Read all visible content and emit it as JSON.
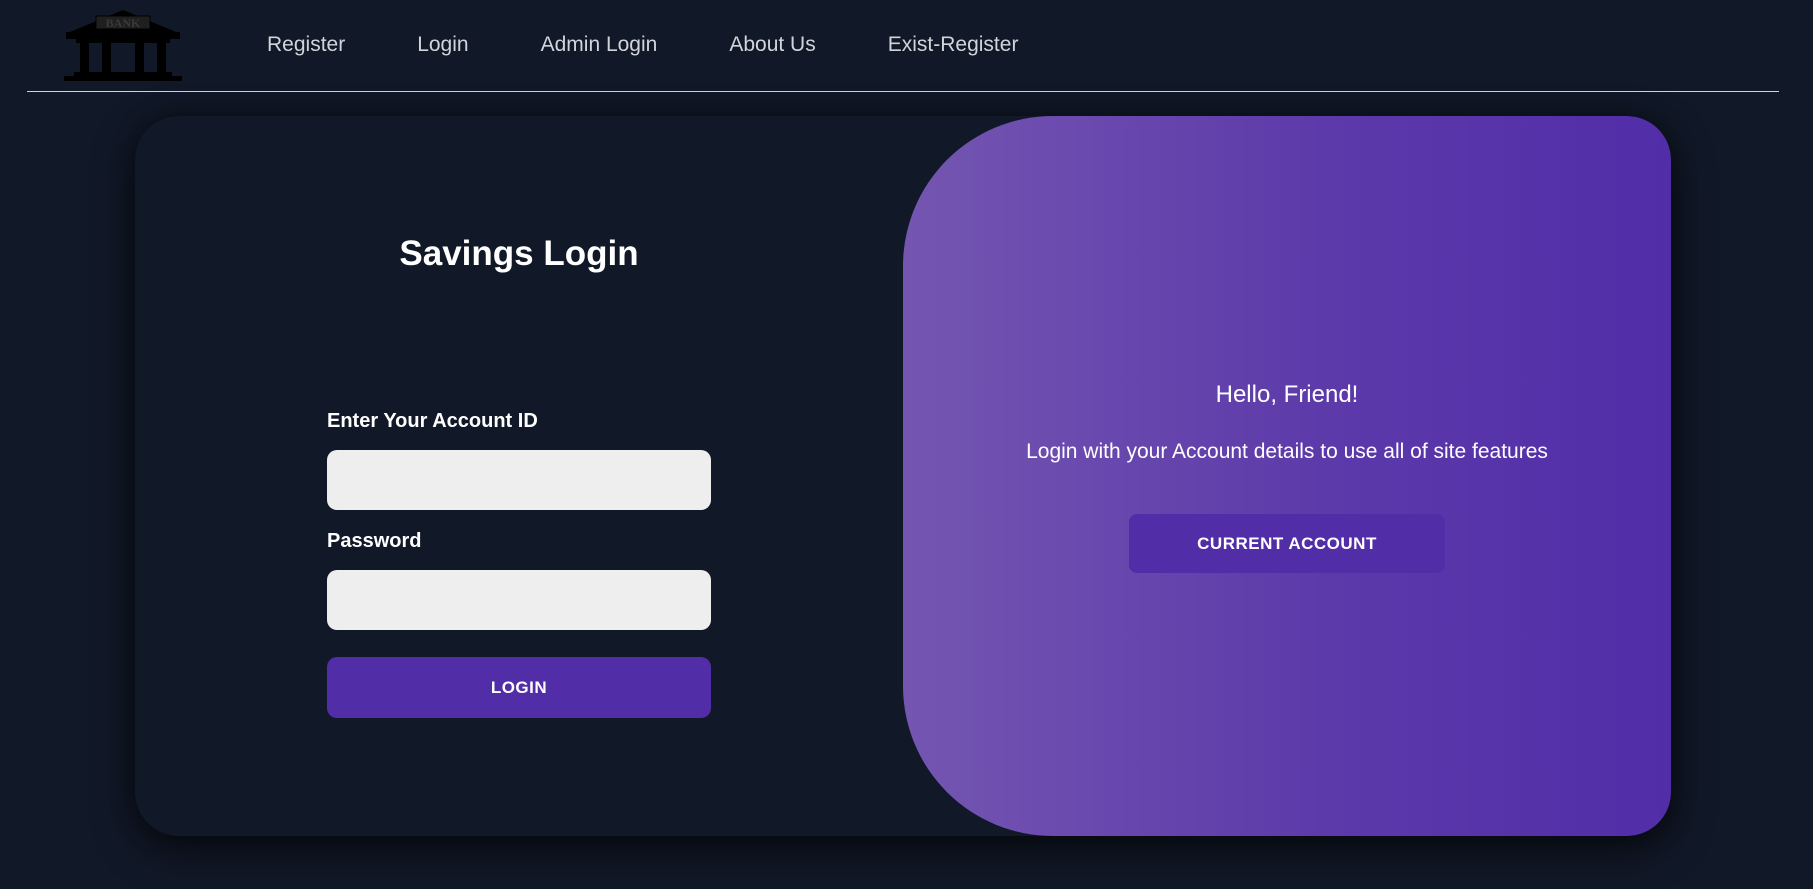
{
  "logo": {
    "text": "BANK",
    "icon": "bank-building-icon"
  },
  "nav": {
    "items": [
      {
        "label": "Register"
      },
      {
        "label": "Login"
      },
      {
        "label": "Admin Login"
      },
      {
        "label": "About Us"
      },
      {
        "label": "Exist-Register"
      }
    ]
  },
  "form": {
    "title": "Savings Login",
    "account_label": "Enter Your Account ID",
    "account_value": "",
    "password_label": "Password",
    "password_value": "",
    "login_label": "LOGIN"
  },
  "toggle": {
    "title": "Hello, Friend!",
    "text": "Login with your Account details to use all of site features",
    "button_label": "CURRENT ACCOUNT"
  },
  "colors": {
    "background": "#111827",
    "accent": "#512da8",
    "gradient_start": "#7456b1",
    "gradient_end": "#512da8",
    "input_bg": "#eeeeee"
  }
}
